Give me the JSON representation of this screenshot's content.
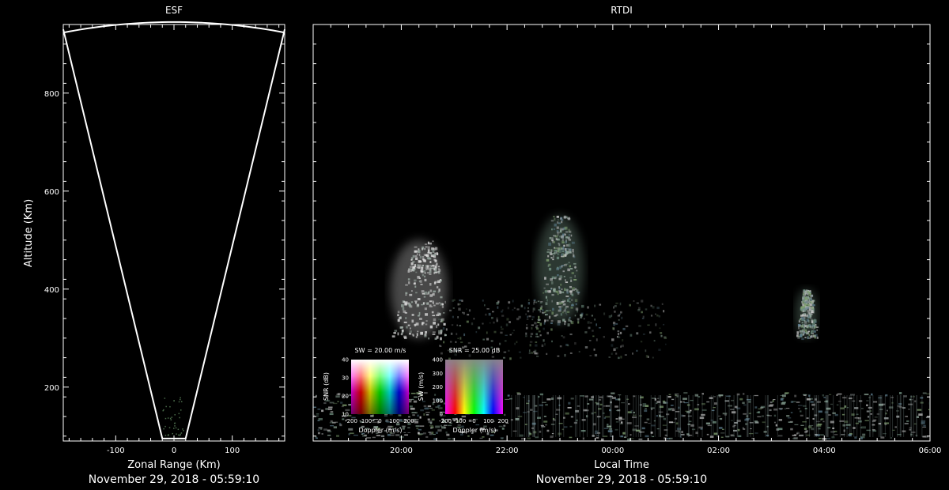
{
  "chart_data": [
    {
      "type": "line",
      "title": "ESF",
      "xlabel": "Zonal Range (Km)",
      "ylabel": "Altitude (Km)",
      "caption": "November 29, 2018 - 05:59:10",
      "xlim": [
        -190,
        190
      ],
      "ylim": [
        90,
        940
      ],
      "xticks": [
        -100,
        0,
        100
      ],
      "yticks": [
        200,
        400,
        600,
        800
      ],
      "grid": false,
      "series": [
        {
          "x": [
            -190,
            -20,
            20,
            190
          ],
          "y": [
            930,
            95,
            95,
            930
          ]
        }
      ],
      "arc": {
        "center_altitude": 95,
        "radius": 850,
        "x_range": [
          -190,
          190
        ]
      }
    },
    {
      "type": "heatmap",
      "title": "RTDI",
      "xlabel": "Local Time",
      "ylabel": "",
      "caption": "November 29, 2018 - 05:59:10",
      "xlim": [
        "18:20",
        "06:00"
      ],
      "ylim": [
        90,
        940
      ],
      "xticks": [
        "20:00",
        "22:00",
        "00:00",
        "02:00",
        "04:00",
        "06:00"
      ],
      "grid": false,
      "plumes": [
        {
          "time": "20:20",
          "base_alt": 300,
          "top_alt": 500
        },
        {
          "time": "23:00",
          "base_alt": 330,
          "top_alt": 550
        },
        {
          "time": "03:40",
          "base_alt": 300,
          "top_alt": 400
        }
      ],
      "bottom_layer": {
        "base_alt": 95,
        "top_alt": 190
      },
      "legends": [
        {
          "title": "SW = 20.00 m/s",
          "xlabel": "Doppler (m/s)",
          "ylabel": "SNR (dB)",
          "xticks": [
            "-200",
            "-100",
            "0",
            "100",
            "200"
          ],
          "yticks": [
            "10",
            "20",
            "30",
            "40"
          ]
        },
        {
          "title": "SNR = 25.00 dB",
          "xlabel": "Doppler (m/s)",
          "ylabel": "SW (m/s)",
          "xticks": [
            "-200",
            "-100",
            "0",
            "100",
            "200"
          ],
          "yticks": [
            "0",
            "100",
            "200",
            "300",
            "400"
          ]
        }
      ]
    }
  ]
}
